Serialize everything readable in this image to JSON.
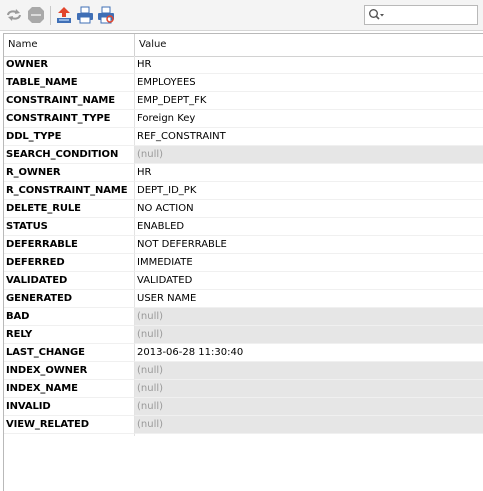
{
  "toolbar": {
    "icons": [
      "refresh-icon",
      "stop-icon",
      "export-icon",
      "print-icon",
      "print-preview-icon"
    ],
    "search": {
      "placeholder": "",
      "value": "",
      "icon": "search-icon"
    }
  },
  "grid": {
    "headers": {
      "name": "Name",
      "value": "Value"
    },
    "rows": [
      {
        "name": "OWNER",
        "value": "HR",
        "is_null": false
      },
      {
        "name": "TABLE_NAME",
        "value": "EMPLOYEES",
        "is_null": false
      },
      {
        "name": "CONSTRAINT_NAME",
        "value": "EMP_DEPT_FK",
        "is_null": false
      },
      {
        "name": "CONSTRAINT_TYPE",
        "value": "Foreign Key",
        "is_null": false
      },
      {
        "name": "DDL_TYPE",
        "value": "REF_CONSTRAINT",
        "is_null": false
      },
      {
        "name": "SEARCH_CONDITION",
        "value": "(null)",
        "is_null": true
      },
      {
        "name": "R_OWNER",
        "value": "HR",
        "is_null": false
      },
      {
        "name": "R_CONSTRAINT_NAME",
        "value": "DEPT_ID_PK",
        "is_null": false
      },
      {
        "name": "DELETE_RULE",
        "value": "NO ACTION",
        "is_null": false
      },
      {
        "name": "STATUS",
        "value": "ENABLED",
        "is_null": false
      },
      {
        "name": "DEFERRABLE",
        "value": "NOT DEFERRABLE",
        "is_null": false
      },
      {
        "name": "DEFERRED",
        "value": "IMMEDIATE",
        "is_null": false
      },
      {
        "name": "VALIDATED",
        "value": "VALIDATED",
        "is_null": false
      },
      {
        "name": "GENERATED",
        "value": "USER NAME",
        "is_null": false
      },
      {
        "name": "BAD",
        "value": "(null)",
        "is_null": true
      },
      {
        "name": "RELY",
        "value": "(null)",
        "is_null": true
      },
      {
        "name": "LAST_CHANGE",
        "value": "2013-06-28 11:30:40",
        "is_null": false
      },
      {
        "name": "INDEX_OWNER",
        "value": "(null)",
        "is_null": true
      },
      {
        "name": "INDEX_NAME",
        "value": "(null)",
        "is_null": true
      },
      {
        "name": "INVALID",
        "value": "(null)",
        "is_null": true
      },
      {
        "name": "VIEW_RELATED",
        "value": "(null)",
        "is_null": true
      }
    ]
  },
  "colors": {
    "null_cell_bg": "#e6e6e6",
    "null_text": "#9a9a9a",
    "grid_line": "#e3e3e3"
  }
}
